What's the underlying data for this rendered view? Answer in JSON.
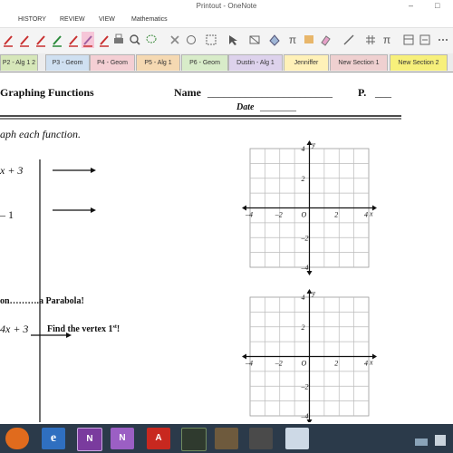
{
  "window": {
    "title": "Printout - OneNote",
    "minimize": "–",
    "maximize": "□"
  },
  "menu": {
    "history": "HISTORY",
    "review": "REVIEW",
    "view": "VIEW",
    "math": "Mathematics"
  },
  "toolbar": {
    "tools": [
      "red-pen-icon",
      "red-pen-icon",
      "green-pen-icon",
      "red-pen-icon",
      "red-pen-icon",
      "highlighter-icon",
      "red-pen-icon",
      "print-icon",
      "search-icon",
      "lasso-icon",
      "eraser-icon",
      "circle-icon",
      "select-box-icon",
      "select-arrow-icon",
      "transform-icon",
      "pi-icon",
      "color-icon",
      "eraser-dropdown-icon",
      "shape-icon",
      "grid-icon",
      "pi-dropdown-icon",
      "expand-icon",
      "more-icon"
    ]
  },
  "tabs": [
    "P2 - Alg 1 2",
    "P3 - Geom",
    "P4 - Geom",
    "P5 - Alg 1",
    "P6 - Geom",
    "Dustin - Alg 1",
    "Jenniffer",
    "New Section 1",
    "New Section 2"
  ],
  "tab_colors": [
    "#d6e7b9",
    "#cfe0f1",
    "#f4cfd4",
    "#f5d9b2",
    "#d8ecc9",
    "#ddd2ec",
    "#fff1b8",
    "#efd0d0",
    "#f7f07b"
  ],
  "worksheet": {
    "heading": "Graphing Functions",
    "name_label": "Name",
    "name_line": "_______________________",
    "period_label": "P.",
    "period_line": "___",
    "date_label": "Date",
    "date_line": "________",
    "instruction": "aph each function.",
    "item1": "x + 3",
    "item2": "– 1",
    "section_label": "on……….a Parabola!",
    "item3": "4x + 3",
    "vertex_hint_pre": "Find the vertex 1",
    "vertex_hint_sup": "st",
    "vertex_hint_post": "!"
  },
  "graph1": {
    "y_label": "y",
    "x_label": "x",
    "origin": "O",
    "x_ticks": [
      "–4",
      "–2",
      "2",
      "4"
    ],
    "y_ticks": [
      "4",
      "2",
      "–2",
      "–4"
    ]
  },
  "graph2": {
    "y_label": "y",
    "x_label": "x",
    "origin": "O",
    "x_ticks": [
      "–4",
      "–2",
      "2",
      "4"
    ],
    "y_ticks": [
      "4",
      "2",
      "–2",
      "–4"
    ]
  },
  "taskbar": {
    "apps": [
      {
        "icon": "firefox-icon",
        "label": ""
      },
      {
        "icon": "ie-icon",
        "label": "e"
      },
      {
        "icon": "onenote-icon",
        "label": "N"
      },
      {
        "icon": "onenote-2013-icon",
        "label": "N"
      },
      {
        "icon": "pdf-icon",
        "label": "A"
      },
      {
        "icon": "terminal-icon",
        "label": ""
      },
      {
        "icon": "camera-icon",
        "label": ""
      },
      {
        "icon": "recorder-icon",
        "label": ""
      },
      {
        "icon": "bird-app-icon",
        "label": ""
      }
    ]
  }
}
